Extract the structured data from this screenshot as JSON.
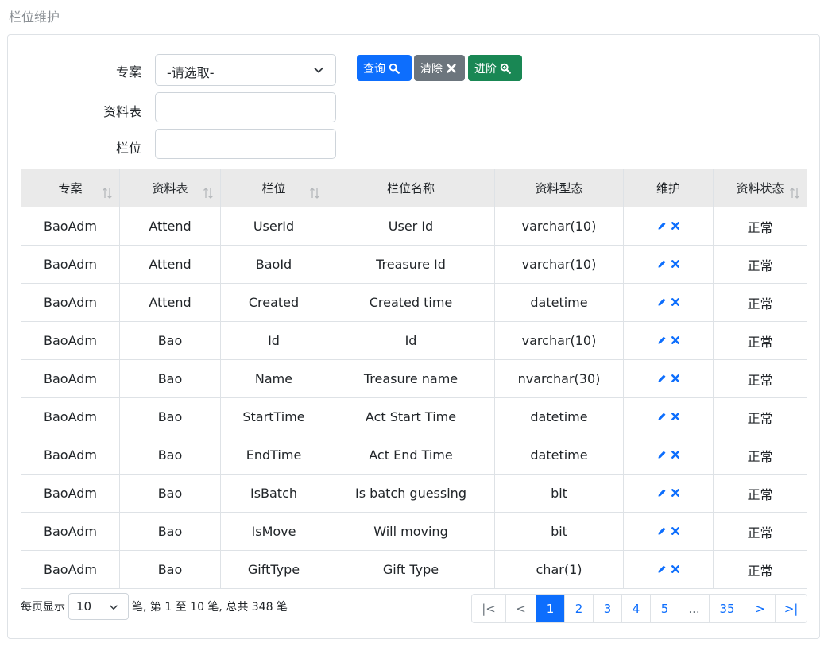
{
  "page": {
    "title": "栏位维护"
  },
  "filters": {
    "project_label": "专案",
    "project_selected": "-请选取-",
    "table_label": "资料表",
    "table_value": "",
    "field_label": "栏位",
    "field_value": ""
  },
  "buttons": {
    "query": "查询",
    "clear": "清除",
    "advanced": "进阶"
  },
  "table": {
    "headers": [
      "专案",
      "资料表",
      "栏位",
      "栏位名称",
      "资料型态",
      "维护",
      "资料状态"
    ],
    "rows": [
      [
        "BaoAdm",
        "Attend",
        "UserId",
        "User Id",
        "varchar(10)",
        "",
        "正常"
      ],
      [
        "BaoAdm",
        "Attend",
        "BaoId",
        "Treasure Id",
        "varchar(10)",
        "",
        "正常"
      ],
      [
        "BaoAdm",
        "Attend",
        "Created",
        "Created time",
        "datetime",
        "",
        "正常"
      ],
      [
        "BaoAdm",
        "Bao",
        "Id",
        "Id",
        "varchar(10)",
        "",
        "正常"
      ],
      [
        "BaoAdm",
        "Bao",
        "Name",
        "Treasure name",
        "nvarchar(30)",
        "",
        "正常"
      ],
      [
        "BaoAdm",
        "Bao",
        "StartTime",
        "Act Start Time",
        "datetime",
        "",
        "正常"
      ],
      [
        "BaoAdm",
        "Bao",
        "EndTime",
        "Act End Time",
        "datetime",
        "",
        "正常"
      ],
      [
        "BaoAdm",
        "Bao",
        "IsBatch",
        "Is batch guessing",
        "bit",
        "",
        "正常"
      ],
      [
        "BaoAdm",
        "Bao",
        "IsMove",
        "Will moving",
        "bit",
        "",
        "正常"
      ],
      [
        "BaoAdm",
        "Bao",
        "GiftType",
        "Gift Type",
        "char(1)",
        "",
        "正常"
      ]
    ]
  },
  "footer": {
    "per_page_label": "每页显示",
    "page_size": "10",
    "summary": "笔, 第 1 至 10 笔, 总共 348 笔"
  },
  "pagination": {
    "first": "|<",
    "prev": "<",
    "pages": [
      "1",
      "2",
      "3",
      "4",
      "5"
    ],
    "ellipsis": "...",
    "last_page": "35",
    "next": ">",
    "last": ">|",
    "current": "1"
  },
  "colors": {
    "primary": "#0d6efd",
    "secondary": "#6c757d",
    "success": "#198754",
    "header_bg": "#eaeaea"
  }
}
